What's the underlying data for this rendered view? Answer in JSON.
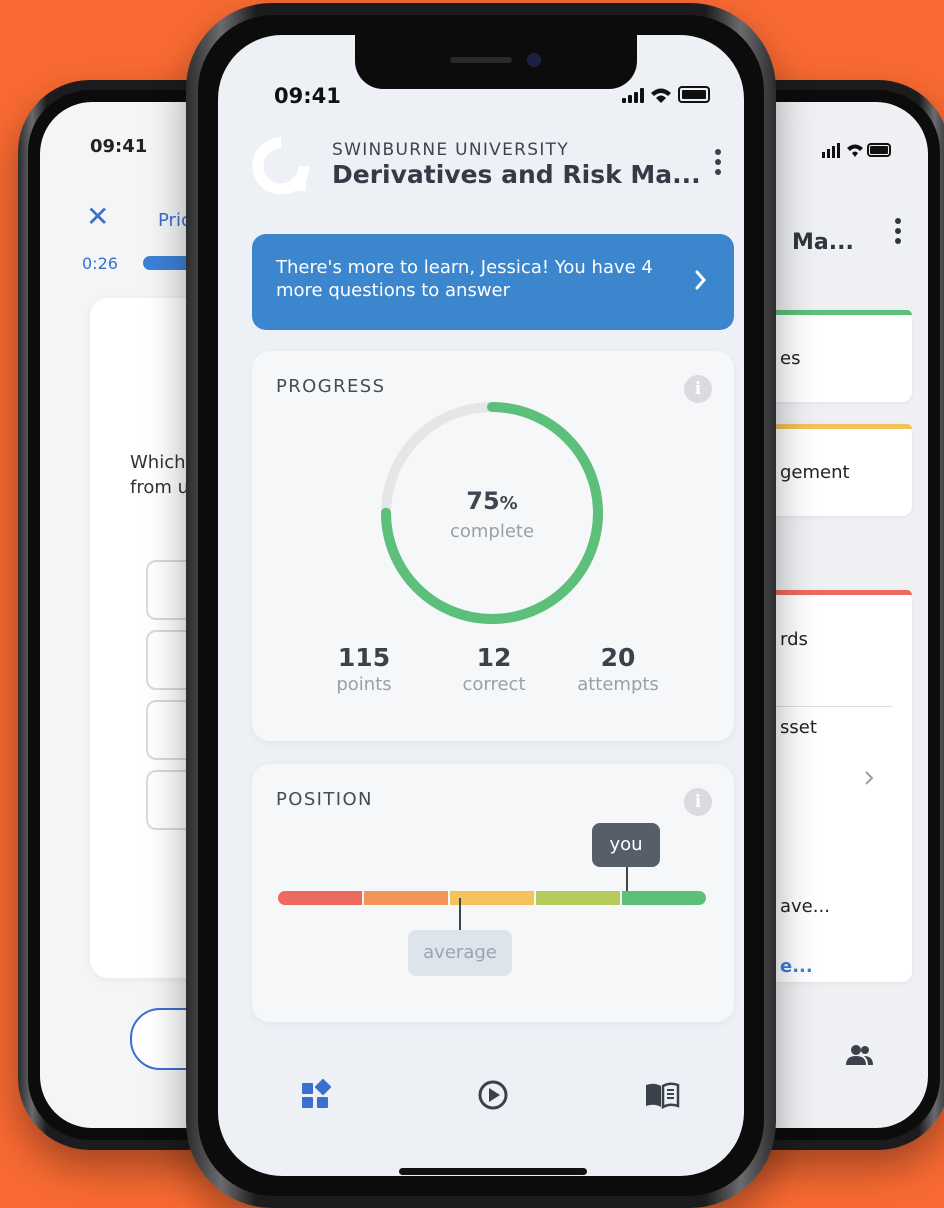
{
  "left_phone": {
    "time": "09:41",
    "title_fragment": "Pric",
    "timer": "0:26",
    "question_fragment": "Which\nfrom u"
  },
  "right_phone": {
    "title_fragment": "Ma...",
    "cards": [
      {
        "text": "es",
        "accent": "#5cbf7a"
      },
      {
        "text": "gement",
        "accent": "#f3c25a"
      },
      {
        "text": "rds",
        "accent": "#ec6a5e"
      }
    ],
    "list_items": [
      "sset",
      "ave..."
    ],
    "link_fragment": "e..."
  },
  "center_phone": {
    "status_time": "09:41",
    "university": "SWINBURNE UNIVERSITY",
    "course_title": "Derivatives and Risk Ma...",
    "banner": {
      "text": "There's more to learn, Jessica! You have 4 more questions to answer",
      "color": "#3b86cd"
    },
    "progress": {
      "title": "PROGRESS",
      "percent_value": "75",
      "percent_unit": "%",
      "percent_fraction": 0.75,
      "complete_label": "complete",
      "ring_color": "#5cbf7a",
      "stats": [
        {
          "value": "115",
          "label": "points"
        },
        {
          "value": "12",
          "label": "correct"
        },
        {
          "value": "20",
          "label": "attempts"
        }
      ]
    },
    "position": {
      "title": "POSITION",
      "you_label": "you",
      "average_label": "average",
      "segment_colors": [
        "#ec6a5e",
        "#f2955a",
        "#f3c25a",
        "#b6cb5e",
        "#5cbf7a"
      ]
    },
    "tabs": [
      "dashboard-icon",
      "play-icon",
      "book-icon"
    ]
  }
}
